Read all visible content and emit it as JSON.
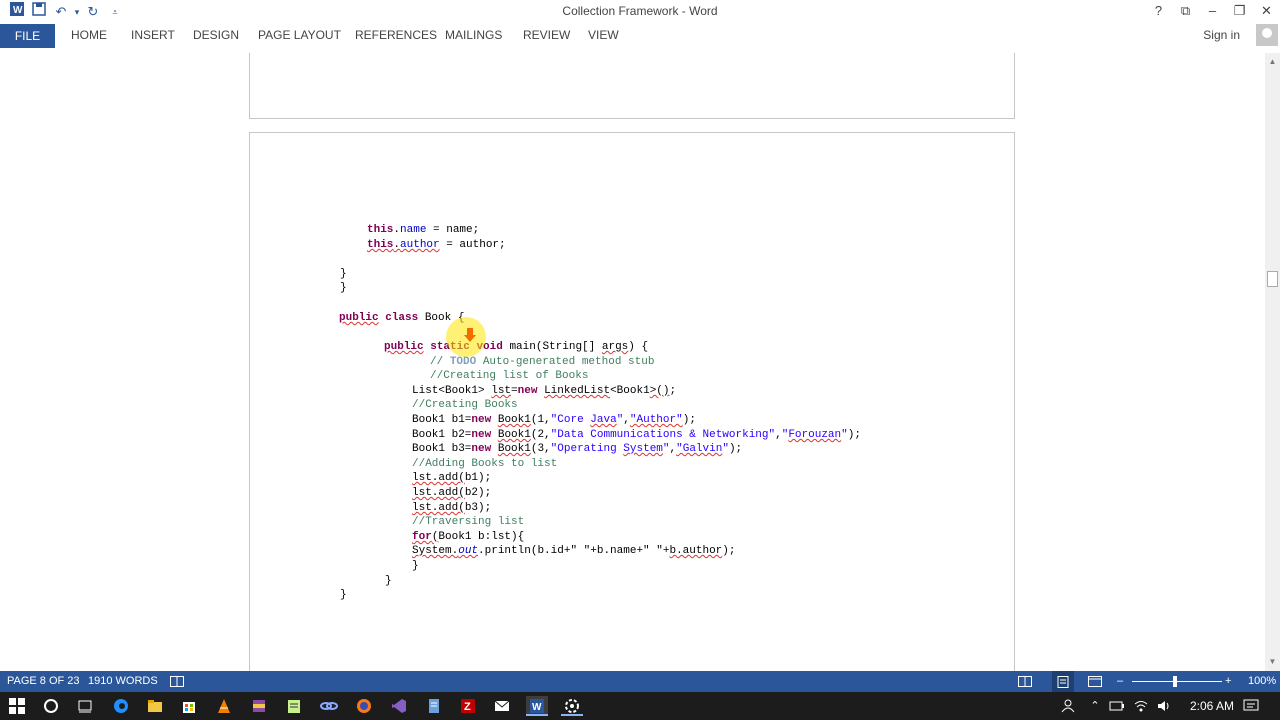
{
  "window": {
    "title": "Collection Framework - Word",
    "controls": {
      "help": "?",
      "restore_ribbon": "⧉",
      "minimize": "–",
      "maximize": "❐",
      "close": "✕"
    }
  },
  "quick_access": {
    "save_icon": "💾",
    "undo_icon": "↶",
    "undo_dropdown": "▾",
    "redo_icon": "↻",
    "customize": "⩡"
  },
  "ribbon": {
    "file_tab": "FILE",
    "tabs": [
      "HOME",
      "INSERT",
      "DESIGN",
      "PAGE LAYOUT",
      "REFERENCES",
      "MAILINGS",
      "REVIEW",
      "VIEW"
    ],
    "sign_in": "Sign in"
  },
  "document": {
    "lines": [
      {
        "html": "<span class=\"kw\">this</span>.<span class=\"fld\">name</span> = name;"
      },
      {
        "html": "<span class=\"kw sq\">this</span><span class=\"sq\">.<span class=\"fld\">author</span></span> = author;"
      },
      {
        "html": "}"
      },
      {
        "html": "}"
      },
      {
        "html": "<span class=\"kw sq\">public</span> <span class=\"kw\">class</span> Book {"
      },
      {
        "html": "<span class=\"kw sq\">public</span> <span class=\"kw\">static</span> <span class=\"kw\">void</span> main(String[] <span class=\"sq\">args</span>) {"
      },
      {
        "html": "<span class=\"cm\">// <span class=\"todo\">TODO</span> Auto-generated method stub</span>"
      },
      {
        "html": "<span class=\"cm\">//Creating list of Books</span>"
      },
      {
        "html": "List&lt;Book1&gt; <span class=\"sq\">lst</span>=<span class=\"kw\">new</span> <span class=\"sq\">LinkedList</span>&lt;Book1<span class=\"sq\">&gt;()</span>;"
      },
      {
        "html": "<span class=\"cm\">//Creating Books</span>"
      },
      {
        "html": "Book1 b1=<span class=\"kw\">new</span> <span class=\"sq\">Book1</span>(1,<span class=\"str\">\"Core <span class=\"sq\">Java</span>\"</span>,<span class=\"str\"><span class=\"sq\">\"Author\"</span></span>);"
      },
      {
        "html": "Book1 b2=<span class=\"kw\">new</span> <span class=\"sq\">Book1</span>(2,<span class=\"str\">\"Data Communications &amp; Networking\"</span>,<span class=\"str\">\"<span class=\"sq\">Forouzan</span>\"</span>);"
      },
      {
        "html": "Book1 b3=<span class=\"kw\">new</span> <span class=\"sq\">Book1</span>(3,<span class=\"str\">\"Operating <span class=\"sq\">System</span>\"</span>,<span class=\"str\"><span class=\"sq\">\"Galvin</span>\"</span>);"
      },
      {
        "html": "<span class=\"cm\">//Adding Books to list</span>"
      },
      {
        "html": "<span class=\"sq\">lst.add(</span>b1);"
      },
      {
        "html": "<span class=\"sq\">lst.add(</span>b2);"
      },
      {
        "html": "<span class=\"sq\">lst.add(</span>b3);"
      },
      {
        "html": "<span class=\"cm\">//Traversing list</span>"
      },
      {
        "html": "<span class=\"kw sq\">for</span><span class=\"sq\">(</span>Book1 b:lst){"
      },
      {
        "html": "<span class=\"sq\">System.<i class=\"fld\">out</i></span>.println(b.id+\" \"+b.name+\" \"+<span class=\"sq\">b.author</span>);"
      },
      {
        "html": "}"
      },
      {
        "html": "}"
      },
      {
        "html": "}"
      }
    ]
  },
  "status_bar": {
    "page": "PAGE 8 OF 23",
    "words": "1910 WORDS",
    "proofing_icon": "📖",
    "zoom": "100%",
    "zoom_minus": "–",
    "zoom_plus": "+"
  },
  "taskbar": {
    "time": "2:06 AM"
  },
  "colors": {
    "accent": "#2b579a",
    "keyword": "#7f0055",
    "comment": "#3f7f5f",
    "string": "#2a00ff"
  }
}
